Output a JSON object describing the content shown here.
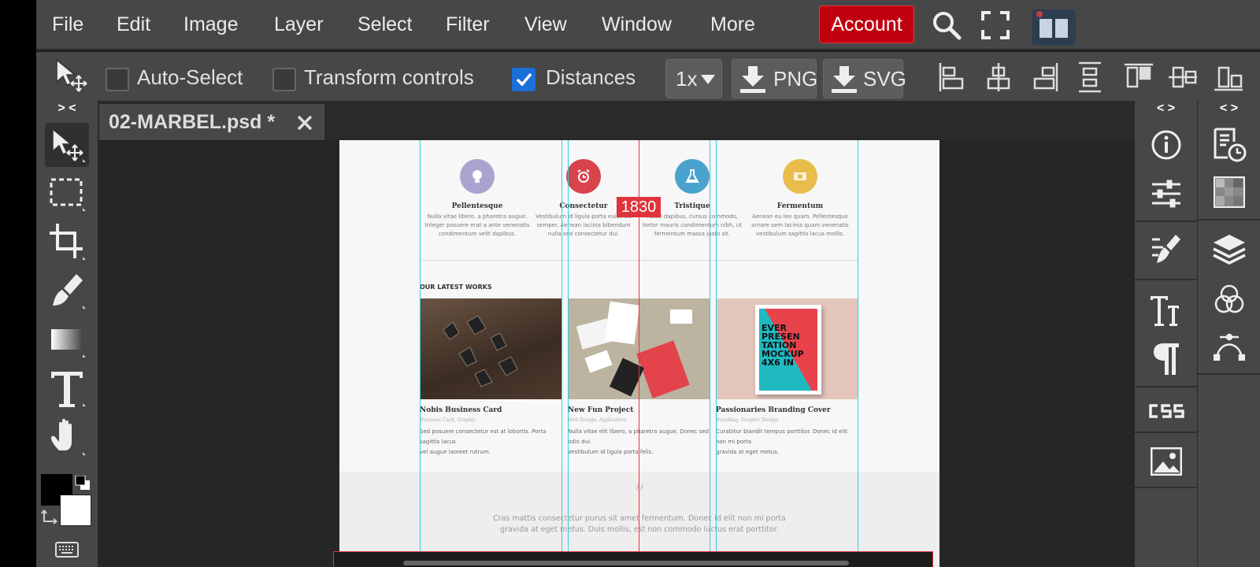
{
  "menu": {
    "items": [
      "File",
      "Edit",
      "Image",
      "Layer",
      "Select",
      "Filter",
      "View",
      "Window",
      "More"
    ],
    "account": "Account"
  },
  "options": {
    "auto_select": {
      "label": "Auto-Select",
      "checked": false
    },
    "transform_controls": {
      "label": "Transform controls",
      "checked": false
    },
    "distances": {
      "label": "Distances",
      "checked": true
    },
    "scale": "1x",
    "export_png": "PNG",
    "export_svg": "SVG"
  },
  "panel_toggles": {
    "left": "> <",
    "right1": "< >",
    "right2": "< >"
  },
  "tab": {
    "name": "02-MARBEL.psd *"
  },
  "document": {
    "measure": "1830",
    "services": [
      {
        "title": "Pellentesque",
        "text": [
          "Nulla vitae libero, a pharetra augue.",
          "Integer posuere erat a ante venenatis",
          "condimentum velit dapibus."
        ],
        "color": "#a9a4cf"
      },
      {
        "title": "Consectetur",
        "text": [
          "Vestibulum id ligula porta euismod",
          "semper. Aenean lacinia bibendum",
          "nulla sed consectetur dui."
        ],
        "color": "#d9434b"
      },
      {
        "title": "Tristique",
        "text": [
          "Fusce dapibus, cursus commodo,",
          "tortor mauris condimentum nibh, ut",
          "fermentum massa justo sit."
        ],
        "color": "#4aa3cc"
      },
      {
        "title": "Fermentum",
        "text": [
          "Aenean eu leo quam. Pellentesque",
          "ornare sem lacinia quam venenatis",
          "vestibulum sagittis lacus mollis."
        ],
        "color": "#e9bd4c"
      }
    ],
    "latest_works_heading": "OUR LATEST WORKS",
    "works": [
      {
        "title": "Nobis Business Card",
        "category": "Business Card, Graphic",
        "desc": [
          "Sed posuere consectetur est at lobortis. Porta sagittis lacus",
          "vel augue laoreet rutrum."
        ]
      },
      {
        "title": "New Fun Project",
        "category": "Web Design, Application",
        "desc": [
          "Nulla vitae elit libero, a pharetra augue. Donec sed odio dui.",
          "Vestibulum id ligula porta felis."
        ]
      },
      {
        "title": "Passionaries Branding Cover",
        "category": "Branding, Graphic Design",
        "desc": [
          "Curabitur blandit tempus porttitor. Donec id elit non mi porta",
          "gravida at eget metus."
        ]
      }
    ],
    "poster_text": [
      "EVER",
      "PRESEN",
      "TATION",
      "MOCKUP",
      "4X6 IN"
    ],
    "quote_mark": "”",
    "quote": [
      "Cras mattis consectetur purus sit amet fermentum. Donec id elit non mi porta",
      "gravida at eget metus. Duis mollis, est non commodo luctus erat porttitor."
    ]
  }
}
